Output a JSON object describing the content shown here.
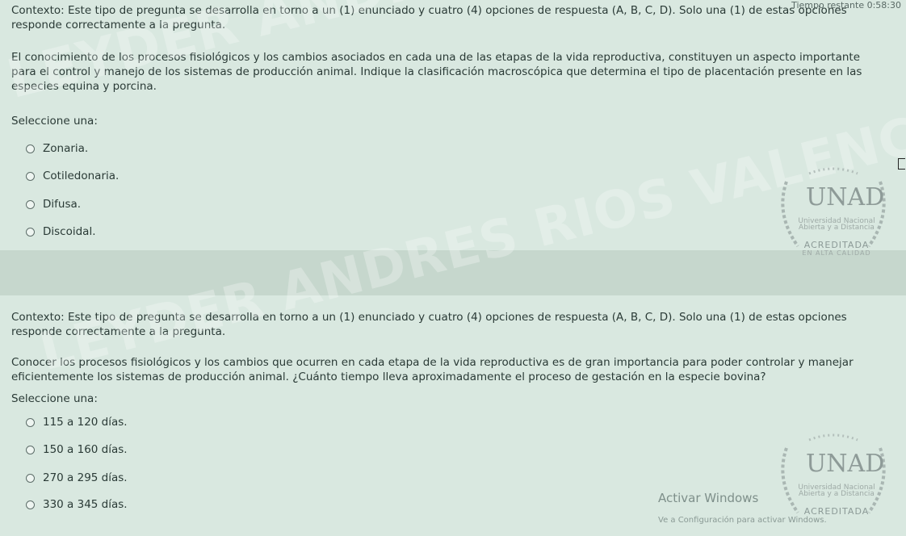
{
  "timer": "Tiempo restante 0:58:30",
  "watermark_text": "LEYDER ANDRES RIOS VALENCIA",
  "question1": {
    "context": "Contexto: Este tipo de pregunta se desarrolla en torno a un (1) enunciado y cuatro (4) opciones de respuesta (A, B, C, D). Solo una (1) de estas opciones responde correctamente a la pregunta.",
    "text": "El conocimiento de los procesos fisiológicos y los cambios asociados en cada una de las etapas de la vida reproductiva, constituyen un aspecto importante para el control y manejo de los sistemas de producción animal. Indique la clasificación macroscópica que determina el tipo de placentación presente en las especies equina y porcina.",
    "select_label": "Seleccione una:",
    "options": [
      "Zonaria.",
      "Cotiledonaria.",
      "Difusa.",
      "Discoidal."
    ]
  },
  "question2": {
    "context": "Contexto: Este tipo de pregunta se desarrolla en torno a un (1) enunciado y cuatro (4) opciones de respuesta (A, B, C, D). Solo una (1) de estas opciones responde correctamente a la pregunta.",
    "text": "Conocer los procesos fisiológicos y los cambios que ocurren en cada etapa de la vida reproductiva es de gran importancia para poder controlar y manejar eficientemente los sistemas de producción animal. ¿Cuánto tiempo lleva aproximadamente el proceso de gestación en la especie bovina?",
    "select_label": "Seleccione una:",
    "options": [
      "115 a 120 días.",
      "150 a 160 días.",
      "270 a 295 días.",
      "330 a 345 días."
    ]
  },
  "logo": {
    "name": "UNAD",
    "line1": "Universidad Nacional",
    "line2": "Abierta y a Distancia",
    "badge": "ACREDITADA",
    "badge_sub": "EN ALTA CALIDAD"
  },
  "activation": {
    "title": "Activar Windows",
    "subtitle": "Ve a Configuración para activar Windows."
  },
  "colors": {
    "panel_bg": "#d9e8e0",
    "page_bg": "#cfdfd6",
    "text": "#2a3a36"
  }
}
